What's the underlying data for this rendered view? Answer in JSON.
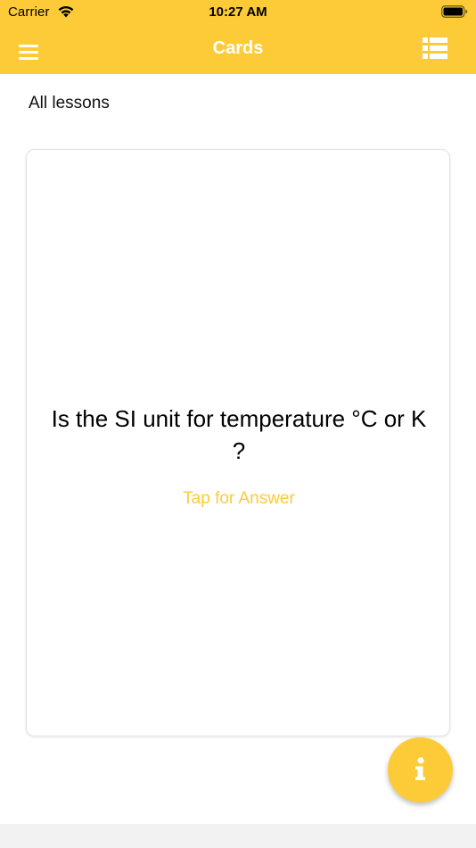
{
  "status_bar": {
    "carrier": "Carrier",
    "time": "10:27 AM",
    "wifi_icon": "wifi-icon",
    "battery_icon": "battery-icon"
  },
  "nav": {
    "title": "Cards",
    "menu_icon": "hamburger-menu-icon",
    "list_icon": "list-view-icon"
  },
  "lesson_filter": "All lessons",
  "card": {
    "question": "Is the SI unit for temperature °C or K ?",
    "hint": "Tap for Answer"
  },
  "fab": {
    "icon": "info-icon"
  },
  "colors": {
    "accent": "#fecb38",
    "nav_text": "#ffffff",
    "background": "#ffffff",
    "bottom_bar": "#f2f2f2"
  }
}
